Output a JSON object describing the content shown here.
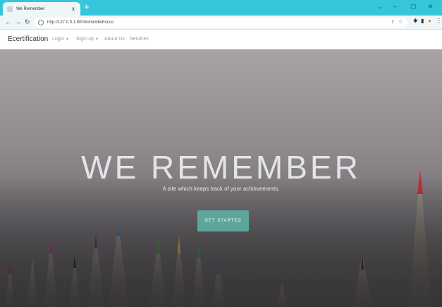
{
  "browser": {
    "tab_title": "We Remember",
    "tab_close": "x",
    "new_tab": "+",
    "url": "http://127.0.0.1:8000/#middleFocus",
    "window_controls": {
      "minimize": "–",
      "maximize": "▢",
      "close": "✕",
      "chevron": "⌄"
    }
  },
  "navbar": {
    "brand": "Ecertification",
    "items": [
      {
        "label": "Login",
        "dropdown": true
      },
      {
        "label": "Sign Up",
        "dropdown": true
      },
      {
        "label": "About Us",
        "dropdown": false
      },
      {
        "label": "Services",
        "dropdown": false
      }
    ]
  },
  "hero": {
    "title": "WE REMEMBER",
    "subtitle": "A site which keeps track of your achievements.",
    "button": "GET STARTED"
  },
  "colors": {
    "tabbar": "#35c6dc",
    "button": "#5ea59b"
  },
  "icons": [
    "back-icon",
    "forward-icon",
    "reload-icon",
    "info-icon",
    "share-icon",
    "star-icon",
    "extensions-icon",
    "sidebar-icon",
    "profile-icon",
    "menu-icon"
  ]
}
